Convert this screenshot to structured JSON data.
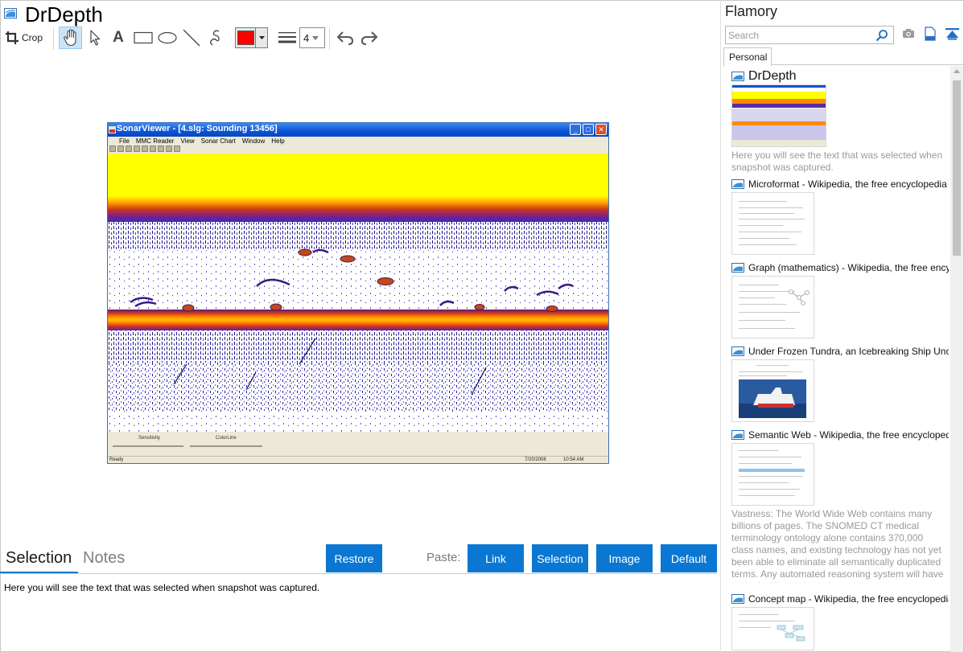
{
  "app": {
    "title": "DrDepth"
  },
  "toolbar": {
    "crop_label": "Crop",
    "stroke_color": "#ff0000",
    "line_width": "4"
  },
  "snapshot": {
    "window_title": "SonarViewer - [4.slg: Sounding 13456]",
    "menu": [
      "File",
      "MMC Reader",
      "View",
      "Sonar Chart",
      "Window",
      "Help"
    ],
    "slider_labels": [
      "Sensitivity",
      "ColorLine"
    ],
    "status": {
      "ready": "Ready",
      "date": "7/20/2008",
      "time": "10:54 AM"
    }
  },
  "bottom": {
    "tabs": [
      {
        "label": "Selection"
      },
      {
        "label": "Notes"
      }
    ],
    "restore_label": "Restore",
    "paste_label": "Paste:",
    "paste_buttons": [
      "Link",
      "Selection",
      "Image",
      "Default"
    ],
    "selection_text": "Here you will see the text that was selected when snapshot was captured."
  },
  "flamory": {
    "title": "Flamory",
    "search_placeholder": "Search",
    "tab": "Personal",
    "snapshots": [
      {
        "title": "DrDepth",
        "description": "Here you will see the text that was selected when snapshot was captured."
      },
      {
        "title": "Microformat - Wikipedia, the free encyclopedia"
      },
      {
        "title": "Graph (mathematics) - Wikipedia, the free ency"
      },
      {
        "title": "Under Frozen Tundra, an Icebreaking Ship Unco"
      },
      {
        "title": "Semantic Web - Wikipedia, the free encycloped",
        "description": "Vastness: The World Wide Web contains many billions of pages. The SNOMED CT medical terminology ontology alone contains 370,000 class names, and existing technology has not yet been able to eliminate all semantically duplicated terms. Any automated reasoning system will have to deal with truly huge inputs."
      },
      {
        "title": "Concept map - Wikipedia, the free encyclopedia"
      }
    ]
  },
  "colors": {
    "accent": "#0a78d2",
    "tab_underline": "#1979c9",
    "sonar_surface": "#ffff00"
  },
  "icons": [
    "app-icon",
    "crop-icon",
    "hand-icon",
    "pointer-icon",
    "text-icon",
    "rectangle-icon",
    "ellipse-icon",
    "line-icon",
    "freehand-icon",
    "line-width-icon",
    "undo-icon",
    "redo-icon",
    "search-icon",
    "camera-icon",
    "page-icon",
    "collapse-icon"
  ]
}
